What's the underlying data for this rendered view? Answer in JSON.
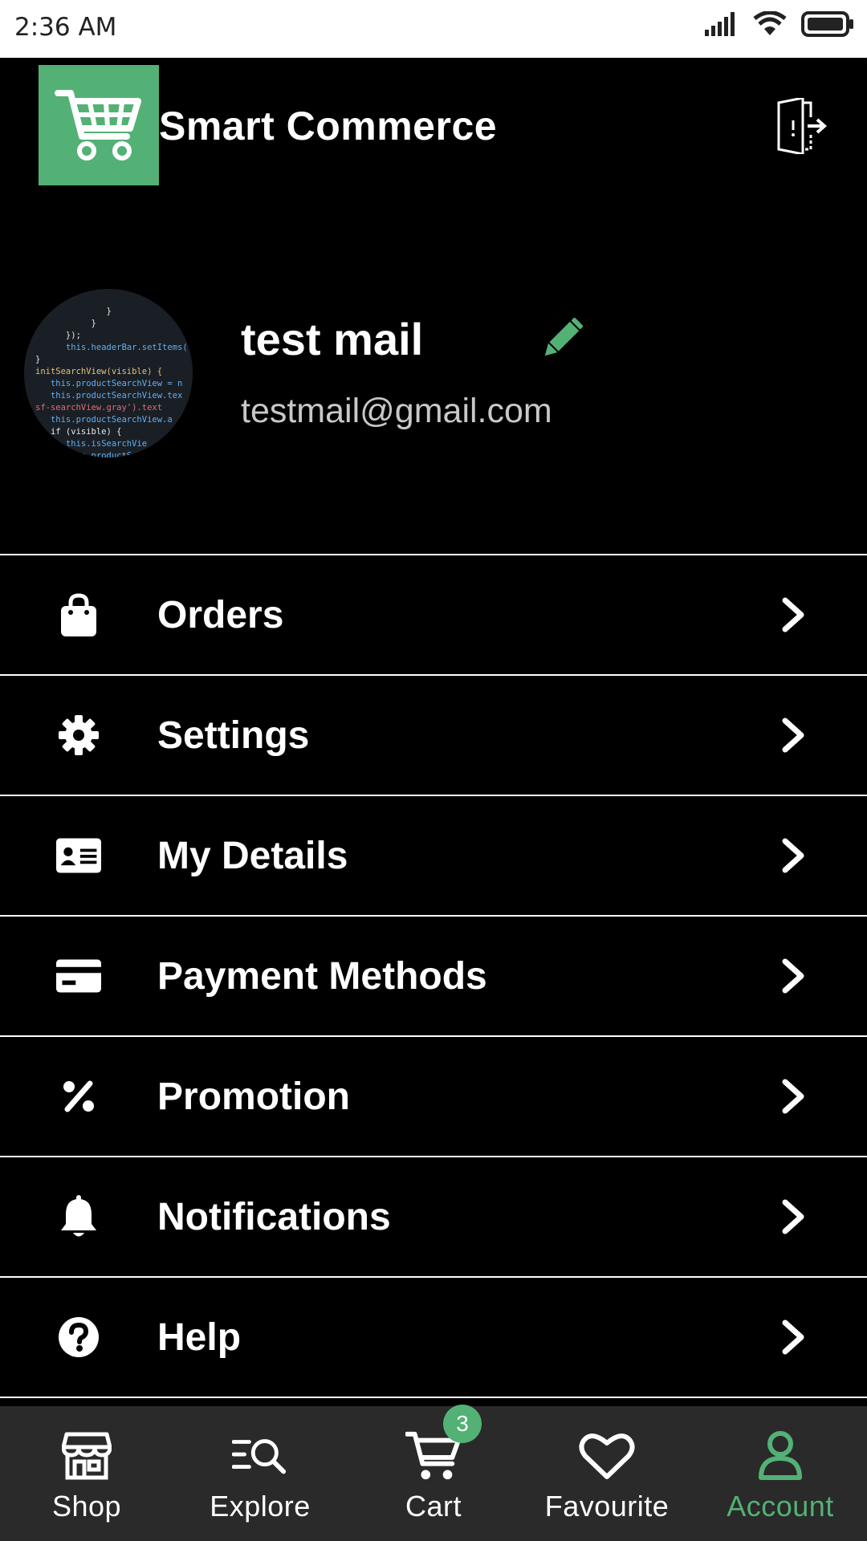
{
  "status_bar": {
    "time": "2:36 AM"
  },
  "header": {
    "title": "Smart Commerce",
    "logo_icon": "shopping-cart-icon",
    "logout_icon": "logout-door-icon"
  },
  "profile": {
    "name": "test mail",
    "email": "testmail@gmail.com",
    "edit_icon": "pencil-icon"
  },
  "menu": {
    "items": [
      {
        "label": "Orders",
        "icon": "shopping-bag-icon"
      },
      {
        "label": "Settings",
        "icon": "gear-icon"
      },
      {
        "label": "My Details",
        "icon": "id-card-icon"
      },
      {
        "label": "Payment Methods",
        "icon": "credit-card-icon"
      },
      {
        "label": "Promotion",
        "icon": "percent-icon"
      },
      {
        "label": "Notifications",
        "icon": "bell-icon"
      },
      {
        "label": "Help",
        "icon": "question-circle-icon"
      }
    ]
  },
  "bottom_nav": {
    "items": [
      {
        "label": "Shop",
        "icon": "store-icon"
      },
      {
        "label": "Explore",
        "icon": "explore-search-icon"
      },
      {
        "label": "Cart",
        "icon": "cart-icon",
        "badge": "3"
      },
      {
        "label": "Favourite",
        "icon": "heart-icon"
      },
      {
        "label": "Account",
        "icon": "user-icon",
        "active": true
      }
    ]
  },
  "colors": {
    "accent": "#53b175",
    "background": "#000000",
    "nav_background": "#2a2a2a"
  }
}
